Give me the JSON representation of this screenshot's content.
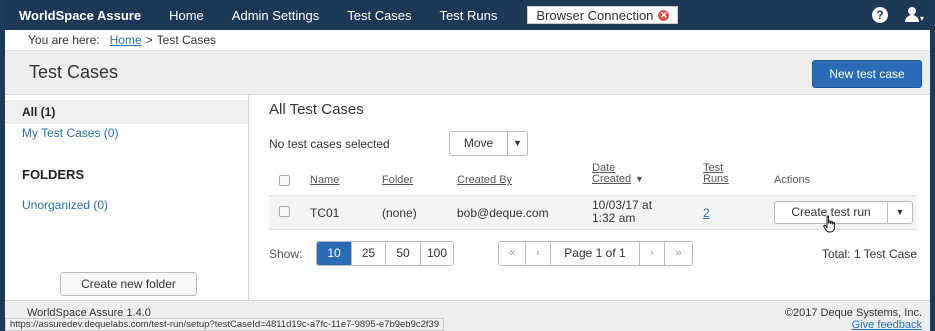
{
  "nav": {
    "brand": "WorldSpace Assure",
    "links": [
      "Home",
      "Admin Settings",
      "Test Cases",
      "Test Runs"
    ],
    "browser_connection": "Browser Connection",
    "help_icon": "question-circle-icon",
    "user_icon": "user-icon"
  },
  "breadcrumb": {
    "prefix": "You are here:",
    "home": "Home",
    "separator": ">",
    "current": "Test Cases"
  },
  "page": {
    "title": "Test Cases",
    "new_button": "New test case"
  },
  "sidebar": {
    "all": "All (1)",
    "my_test_cases": "My Test Cases (0)",
    "folders_heading": "FOLDERS",
    "unorganized": "Unorganized (0)",
    "create_folder": "Create new folder"
  },
  "main": {
    "heading": "All Test Cases",
    "selection_text": "No test cases selected",
    "move_label": "Move",
    "columns": {
      "name": "Name",
      "folder": "Folder",
      "created_by": "Created By",
      "date_created_1": "Date",
      "date_created_2": "Created",
      "test_runs_1": "Test",
      "test_runs_2": "Runs",
      "actions": "Actions"
    },
    "rows": [
      {
        "name": "TC01",
        "folder": "(none)",
        "created_by": "bob@deque.com",
        "date_1": "10/03/17 at",
        "date_2": "1:32 am",
        "test_runs": "2",
        "action": "Create test run"
      }
    ],
    "show_label": "Show:",
    "page_sizes": [
      "10",
      "25",
      "50",
      "100"
    ],
    "active_page_size": "10",
    "pager": {
      "first": "«",
      "prev": "‹",
      "label": "Page 1 of 1",
      "next": "›",
      "last": "»"
    },
    "total": "Total: 1 Test Case"
  },
  "footer": {
    "version": "WorldSpace Assure 1.4.0",
    "copyright": "©2017 Deque Systems, Inc.",
    "feedback": "Give feedback",
    "status_url": "https://assuredev.dequelabs.com/test-run/setup?testCaseId=4811d19c-a7fc-11e7-9895-e7b9eb9c2f39"
  },
  "colors": {
    "nav_bg": "#1d3757",
    "primary": "#2a6cb5",
    "link": "#2a6fb0",
    "error": "#d9534f"
  }
}
